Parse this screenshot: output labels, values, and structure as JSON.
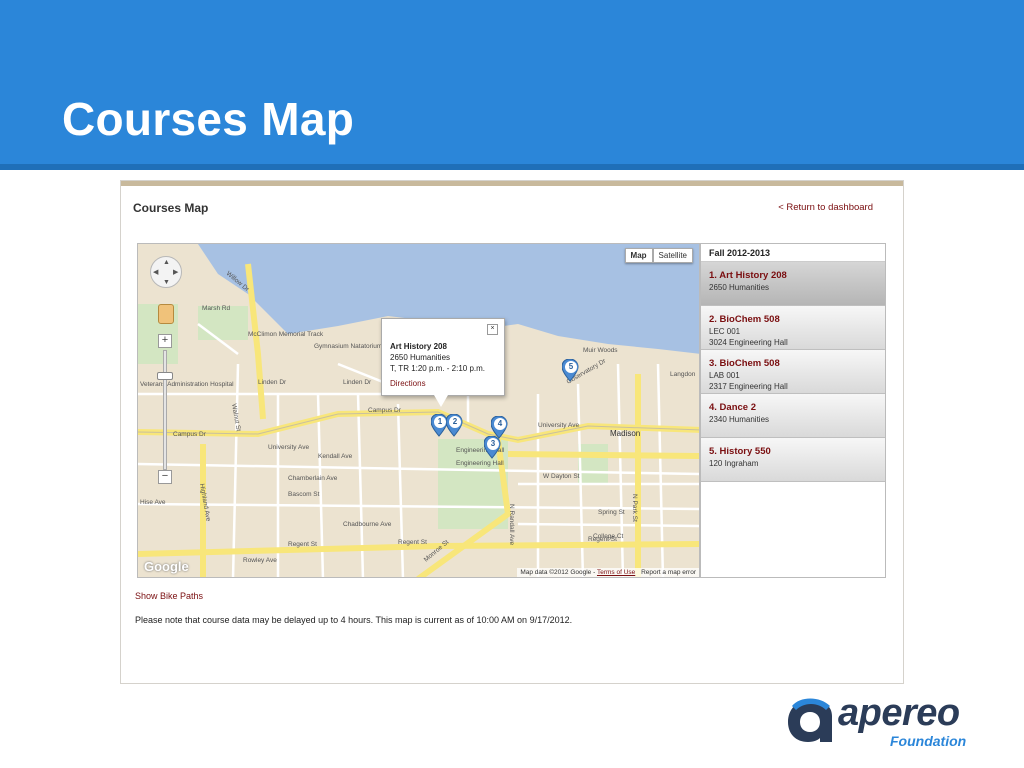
{
  "slide": {
    "title": "Courses Map",
    "header_color": "#2b86d9"
  },
  "app": {
    "title": "Courses Map",
    "return_link": "< Return to dashboard",
    "show_bike_paths": "Show Bike Paths",
    "data_note": "Please note that course data may be delayed up to 4 hours. This map is current as of 10:00 AM on 9/17/2012."
  },
  "map": {
    "type_buttons": [
      "Map",
      "Satellite"
    ],
    "active_type": "Map",
    "google_logo": "Google",
    "attribution": "Map data ©2012 Google -",
    "terms_link": "Terms of Use",
    "report_link": "Report a map error",
    "labels": [
      "Campus Dr",
      "Campus Dr",
      "University Ave",
      "University Ave",
      "Regent St",
      "Regent St",
      "Regent St",
      "Madison",
      "Muir Woods",
      "Engineering Mall",
      "Engineering Hall",
      "N Randall Ave",
      "N Park St",
      "Linden Dr",
      "Linden Dr",
      "Observatory Dr",
      "McClimon Memorial Track",
      "Gymnasium Natatorium",
      "Highland Ave",
      "Bascom St",
      "Chamberlain Ave",
      "Kendall Ave",
      "W Dayton St",
      "Spring St",
      "College Ct",
      "Rowley Ave",
      "Chadbourne Ave",
      "Monroe St",
      "Langdon",
      "Hise Ave",
      "Veterans Administration Hospital",
      "Marsh Rd",
      "Willow Dr",
      "Walnut St"
    ],
    "markers": [
      "1",
      "2",
      "3",
      "4",
      "5"
    ],
    "info_window": {
      "title": "Art History 208",
      "location": "2650 Humanities",
      "schedule": "T, TR 1:20 p.m. - 2:10 p.m.",
      "directions": "Directions",
      "close": "×"
    }
  },
  "courses": {
    "term": "Fall 2012-2013",
    "selected_index": 0,
    "items": [
      {
        "name": "1. Art History 208",
        "lines": [
          "2650 Humanities"
        ]
      },
      {
        "name": "2. BioChem 508",
        "lines": [
          "LEC 001",
          "3024 Engineering Hall"
        ]
      },
      {
        "name": "3. BioChem 508",
        "lines": [
          "LAB 001",
          "2317 Engineering Hall"
        ]
      },
      {
        "name": "4. Dance 2",
        "lines": [
          "2340 Humanities"
        ]
      },
      {
        "name": "5. History 550",
        "lines": [
          "120 Ingraham"
        ]
      }
    ]
  },
  "logo": {
    "word": "apereo",
    "sub": "Foundation"
  },
  "colors": {
    "link": "#7a0e10",
    "water": "#a7c1e3",
    "land": "#ece3d0",
    "road": "#f8e67a"
  }
}
